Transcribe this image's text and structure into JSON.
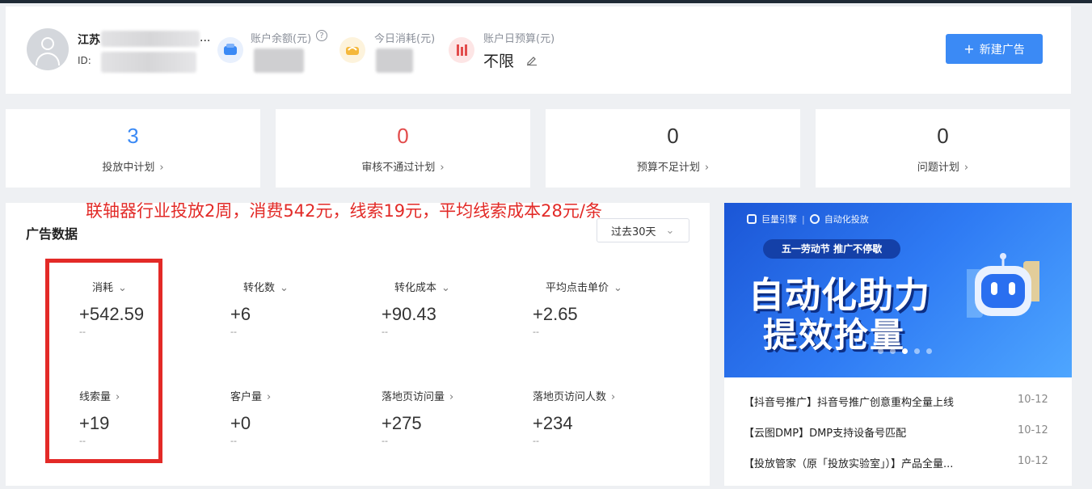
{
  "account": {
    "name": "江苏",
    "name_suffix": "...",
    "id_label": "ID:",
    "balance_label": "账户余额(元)",
    "today_spend_label": "今日消耗(元)",
    "daily_budget_label": "账户日预算(元)",
    "daily_budget_value": "不限",
    "new_ad_label": "新建广告"
  },
  "plans": [
    {
      "count": "3",
      "label": "投放中计划",
      "color": "#3b8af5"
    },
    {
      "count": "0",
      "label": "审核不通过计划",
      "color": "#e24b4b"
    },
    {
      "count": "0",
      "label": "预算不足计划",
      "color": "#333333"
    },
    {
      "count": "0",
      "label": "问题计划",
      "color": "#333333"
    }
  ],
  "annotation": "联轴器行业投放2周，消费542元，线索19元，平均线索成本28元/条",
  "ad_data": {
    "title": "广告数据",
    "range": "过去30天",
    "metrics": [
      {
        "label": "消耗",
        "value": "+542.59",
        "sub": "--",
        "arrow": "⌄"
      },
      {
        "label": "转化数",
        "value": "+6",
        "sub": "--",
        "arrow": "⌄"
      },
      {
        "label": "转化成本",
        "value": "+90.43",
        "sub": "--",
        "arrow": "⌄"
      },
      {
        "label": "平均点击单价",
        "value": "+2.65",
        "sub": "--",
        "arrow": "⌄"
      },
      {
        "label": "线索量",
        "value": "+19",
        "sub": "--",
        "arrow": "›"
      },
      {
        "label": "客户量",
        "value": "+0",
        "sub": "--",
        "arrow": "›"
      },
      {
        "label": "落地页访问量",
        "value": "+275",
        "sub": "--",
        "arrow": "›"
      },
      {
        "label": "落地页访问人数",
        "value": "+234",
        "sub": "--",
        "arrow": "›"
      }
    ]
  },
  "banner": {
    "brand": "巨量引擎",
    "brand2": "自动化投放",
    "pill": "五一劳动节 推广不停歇",
    "headline1": "自动化助力",
    "headline2": "提效抢量"
  },
  "news": [
    {
      "title": "【抖音号推广】抖音号推广创意重构全量上线",
      "date": "10-12"
    },
    {
      "title": "【云图DMP】DMP支持设备号匹配",
      "date": "10-12"
    },
    {
      "title": "【投放管家（原「投放实验室」）】产品全量...",
      "date": "10-12"
    }
  ]
}
